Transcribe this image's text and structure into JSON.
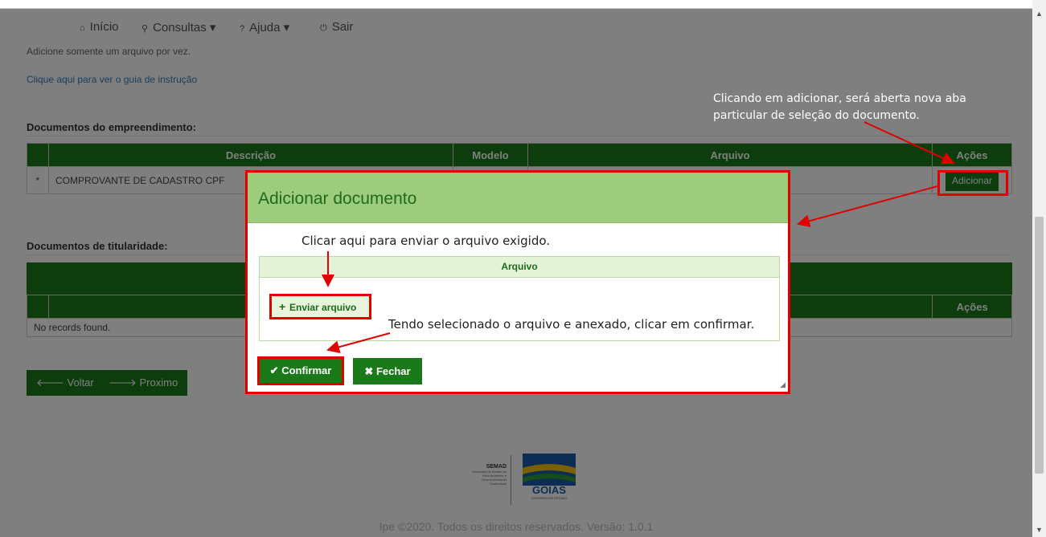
{
  "nav": {
    "items": [
      {
        "icon": "home-icon",
        "glyph": "⌂",
        "label": "Início"
      },
      {
        "icon": "search-icon",
        "glyph": "⚲",
        "label": "Consultas ▾"
      },
      {
        "icon": "help-icon",
        "glyph": "?",
        "label": "Ajuda ▾"
      },
      {
        "icon": "power-icon",
        "glyph": "⏻",
        "label": "Sair"
      }
    ]
  },
  "page": {
    "hint": "Adicione somente um arquivo por vez.",
    "guide_link": "Clique aqui para ver o guia de instrução",
    "section1_title": "Documentos do empreendimento:",
    "table1": {
      "headers": [
        "",
        "Descrição",
        "Modelo",
        "Arquivo",
        "Ações"
      ],
      "row": {
        "required": "*",
        "description": "COMPROVANTE DE CADASTRO CPF",
        "action": "Adicionar"
      }
    },
    "section2_title": "Documentos de titularidade:",
    "table2": {
      "headers": [
        "",
        "",
        "Ações"
      ],
      "empty": "No records found."
    },
    "back_label": "Voltar",
    "next_label": "Proximo"
  },
  "footer": {
    "semad": "SEMAD",
    "semad_sub": "Secretaria de Estado de Meio Ambiente e Desenvolvimento Sustentável",
    "gov_tagline": "Somos todos",
    "gov_name": "GOIÁS",
    "gov_sub": "GOVERNO DO ESTADO",
    "copyright": "Ipe ©2020. Todos os direitos reservados. Versão: 1.0.1"
  },
  "annotations": {
    "add_note_line1": "Clicando em adicionar, será aberta nova aba",
    "add_note_line2": "particular de seleção do documento.",
    "send_note": "Clicar aqui para enviar o arquivo exigido.",
    "confirm_note": "Tendo selecionado o arquivo e anexado, clicar em confirmar."
  },
  "modal": {
    "title": "Adicionar documento",
    "file_header": "Arquivo",
    "send_label": "Enviar arquivo",
    "confirm_label": "Confirmar",
    "close_label": "Fechar"
  },
  "colors": {
    "accent": "#1a7a1a",
    "modal_header": "#9ecc7d",
    "highlight": "#e00000"
  }
}
